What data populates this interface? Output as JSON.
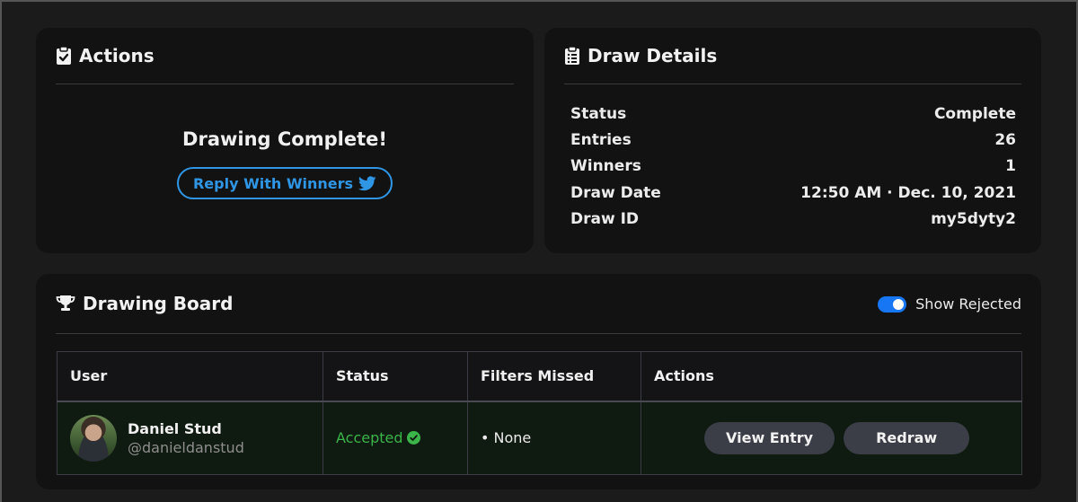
{
  "actions": {
    "title": "Actions",
    "message": "Drawing Complete!",
    "reply_label": "Reply With Winners"
  },
  "details": {
    "title": "Draw Details",
    "rows": [
      {
        "label": "Status",
        "value": "Complete"
      },
      {
        "label": "Entries",
        "value": "26"
      },
      {
        "label": "Winners",
        "value": "1"
      },
      {
        "label": "Draw Date",
        "value": "12:50 AM · Dec. 10, 2021"
      },
      {
        "label": "Draw ID",
        "value": "my5dyty2"
      }
    ]
  },
  "board": {
    "title": "Drawing Board",
    "toggle_label": "Show Rejected",
    "toggle_on": true,
    "columns": [
      "User",
      "Status",
      "Filters Missed",
      "Actions"
    ],
    "rows": [
      {
        "name": "Daniel Stud",
        "handle": "@danieldanstud",
        "status": "Accepted",
        "filters": "• None",
        "view_label": "View Entry",
        "redraw_label": "Redraw"
      }
    ]
  },
  "colors": {
    "accent_blue": "#2f96e6",
    "toggle_blue": "#1676f3",
    "success_green": "#3bb54a"
  }
}
